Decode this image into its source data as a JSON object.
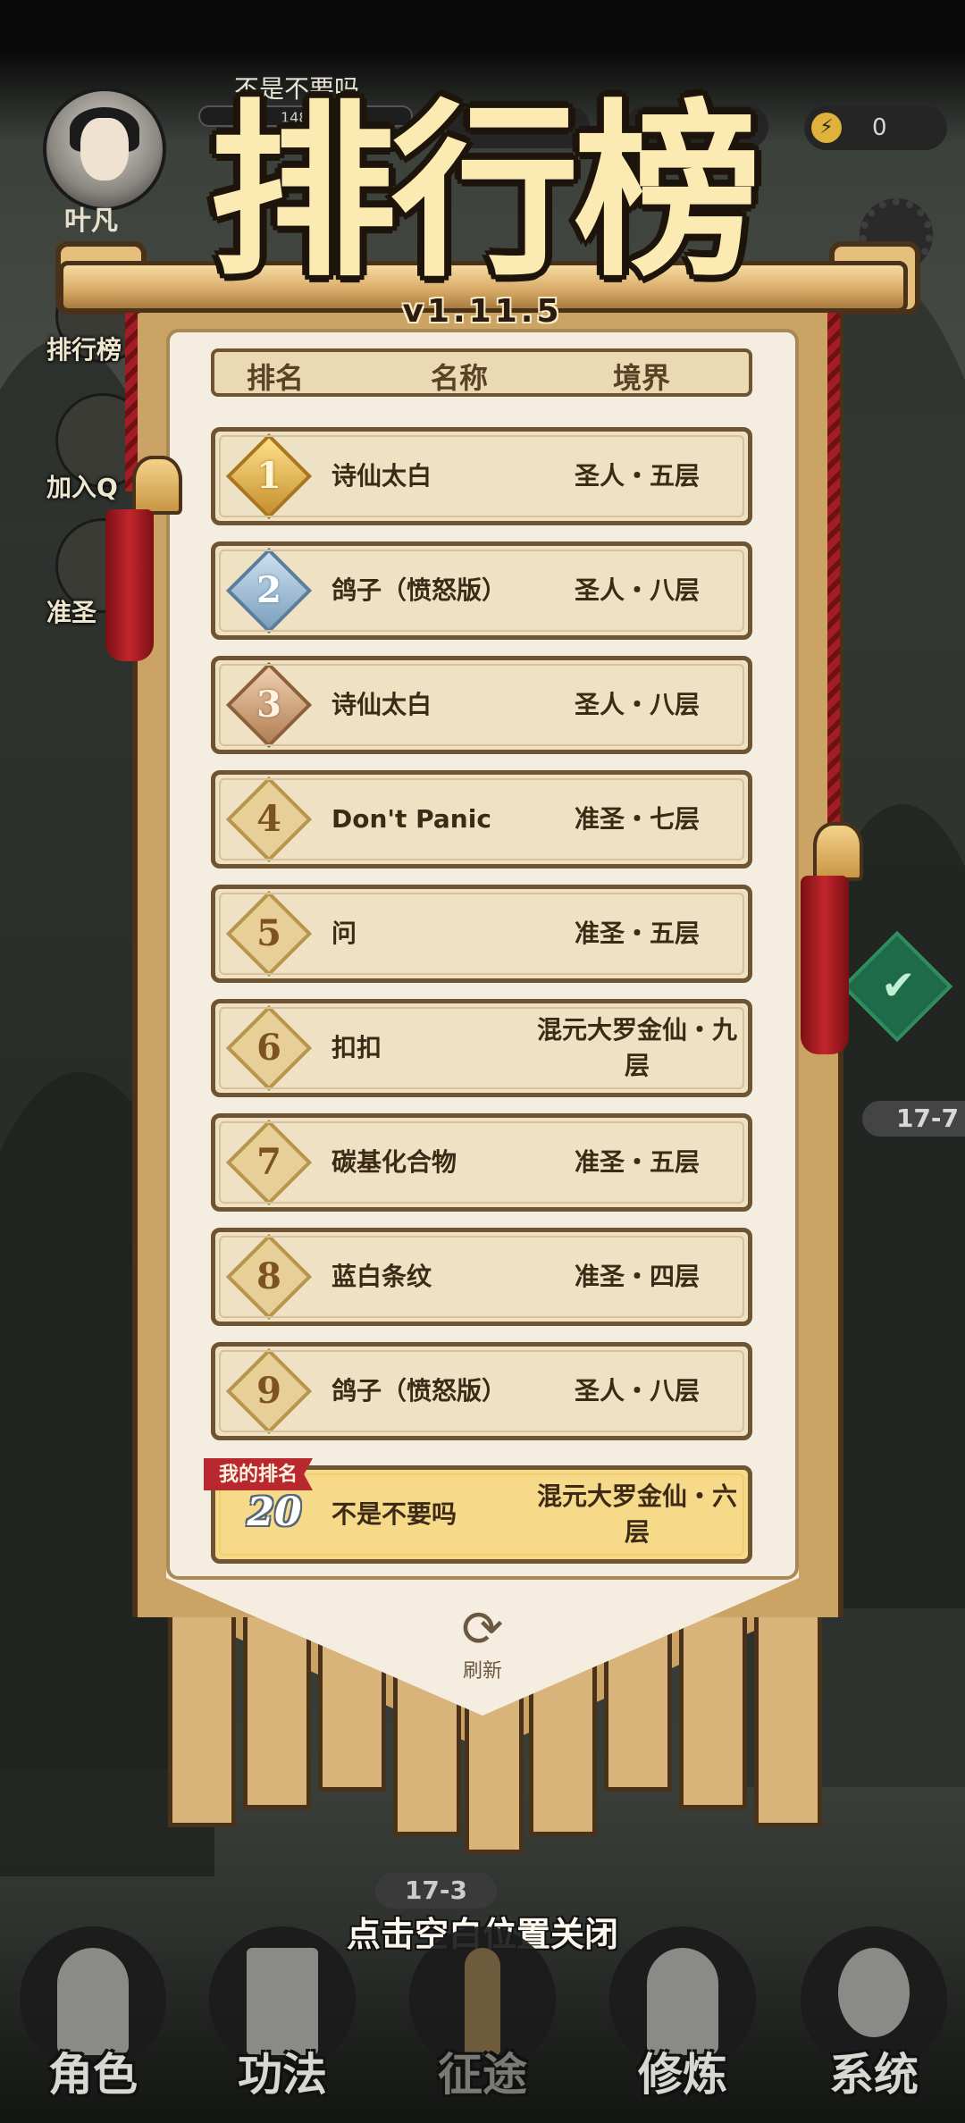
{
  "hud": {
    "player_name": "叶凡",
    "nickname": "不是不要吗",
    "bar_text": "148/",
    "energy_value": "0",
    "energy_icon": "lightning-icon"
  },
  "side_menu": [
    {
      "label": "排行榜",
      "icon": "leaderboard-icon"
    },
    {
      "label": "加入Q",
      "icon": "penguin-icon"
    },
    {
      "label": "准圣",
      "icon": "gift-icon"
    }
  ],
  "map": {
    "stage_right": "17-7",
    "stage_bottom": "17-3"
  },
  "leaderboard": {
    "title": "排行榜",
    "version": "v1.11.5",
    "headers": {
      "rank": "排名",
      "name": "名称",
      "realm": "境界"
    },
    "rows": [
      {
        "rank": "1",
        "name": "诗仙太白",
        "realm": "圣人・五层"
      },
      {
        "rank": "2",
        "name": "鸽子（愤怒版）",
        "realm": "圣人・八层"
      },
      {
        "rank": "3",
        "name": "诗仙太白",
        "realm": "圣人・八层"
      },
      {
        "rank": "4",
        "name": "Don't Panic",
        "realm": "准圣・七层"
      },
      {
        "rank": "5",
        "name": "问",
        "realm": "准圣・五层"
      },
      {
        "rank": "6",
        "name": "扣扣",
        "realm": "混元大罗金仙・九层"
      },
      {
        "rank": "7",
        "name": "碳基化合物",
        "realm": "准圣・五层"
      },
      {
        "rank": "8",
        "name": "蓝白条纹",
        "realm": "准圣・四层"
      },
      {
        "rank": "9",
        "name": "鸽子（愤怒版）",
        "realm": "圣人・八层"
      }
    ],
    "my_rank": {
      "tag": "我的排名",
      "rank": "20",
      "name": "不是不要吗",
      "realm": "混元大罗金仙・六层"
    },
    "refresh_label": "刷新",
    "close_hint": "点击空白位置关闭"
  },
  "bottom_nav": [
    {
      "label": "角色",
      "icon": "character-icon"
    },
    {
      "label": "功法",
      "icon": "scroll-book-icon"
    },
    {
      "label": "征途",
      "icon": "sword-icon"
    },
    {
      "label": "修炼",
      "icon": "meditation-icon"
    },
    {
      "label": "系统",
      "icon": "system-girl-icon"
    }
  ],
  "colors": {
    "banner_wood": "#cba465",
    "paper": "#f5ede0",
    "row_bg": "#efe2c4",
    "my_row_bg": "#f7d98a",
    "tag_red": "#b8282e",
    "title_cream": "#fbeab2"
  }
}
